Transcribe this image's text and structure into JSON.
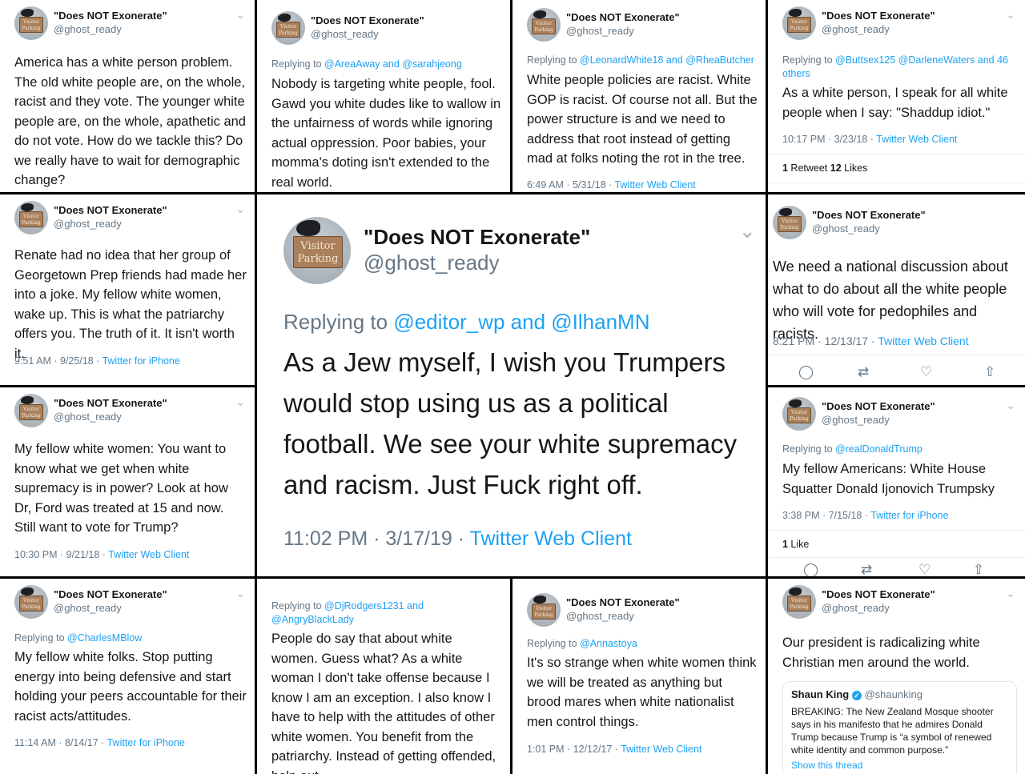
{
  "account": {
    "name": "\"Does NOT Exonerate\"",
    "handle": "@ghost_ready",
    "avatar_sign_text": "Visitor Parking"
  },
  "tweets": [
    {
      "body": "America has a white person problem. The old white people are, on the whole, racist and they vote. The younger white people are, on the whole, apathetic and do not vote. How do we tackle this? Do we really have to wait for demographic change?"
    },
    {
      "reply_prefix": "Replying to ",
      "reply_to": "@AreaAway and @sarahjeong",
      "body": "Nobody is targeting white people, fool. Gawd you white dudes like to wallow in the unfairness of words while ignoring actual oppression. Poor  babies, your momma's doting isn't extended to the real world."
    },
    {
      "reply_prefix": "Replying to ",
      "reply_to": "@LeonardWhite18 and @RheaButcher",
      "body": "White people policies are racist. White GOP is racist. Of course not all. But the power structure is and we need to address that root instead of getting mad at folks noting the rot in the tree.",
      "time": "6:49 AM · 5/31/18 · ",
      "source": "Twitter Web Client"
    },
    {
      "reply_prefix": "Replying to ",
      "reply_to": "@Buttsex125 @DarleneWaters and 46 others",
      "body": "As a white person, I speak for all white people when I say: \"Shaddup idiot.\"",
      "time": "10:17 PM · 3/23/18 · ",
      "source": "Twitter Web Client",
      "retweets": "1",
      "retweets_label": " Retweet ",
      "likes": "12",
      "likes_label": " Likes"
    },
    {
      "body": "Renate had no idea that her group of Georgetown Prep friends had made her into a joke. My fellow white women, wake up. This is what the patriarchy offers you. The truth of it. It isn't worth it.",
      "time": "9:51 AM · 9/25/18 · ",
      "source": "Twitter for iPhone"
    },
    {
      "reply_prefix": "Replying to ",
      "reply_to": "@editor_wp and @IlhanMN",
      "body": "As a Jew myself, I wish you Trumpers would stop using us as a political football. We see your white supremacy and racism. Just Fuck right off.",
      "time": "11:02 PM · 3/17/19 · ",
      "source": "Twitter Web Client"
    },
    {
      "body": "We need a national discussion about what to do about all the white people who will vote for pedophiles and racists.",
      "time": "8:21 PM · 12/13/17 · ",
      "source": "Twitter Web Client"
    },
    {
      "body": "My fellow white women: You want to know what we get when white supremacy is in power? Look at how Dr, Ford was treated at 15 and now. Still want to vote for Trump?",
      "time": "10:30 PM · 9/21/18 · ",
      "source": "Twitter Web Client"
    },
    {
      "reply_prefix": "Replying to ",
      "reply_to": "@realDonaldTrump",
      "body": "My fellow Americans: White House Squatter Donald Ijonovich Trumpsky",
      "time": "3:38 PM · 7/15/18 · ",
      "source": "Twitter for iPhone",
      "likes": "1",
      "likes_label": " Like"
    },
    {
      "reply_prefix": "Replying to ",
      "reply_to": "@CharlesMBlow",
      "body": "My fellow white folks. Stop putting energy into being defensive and start holding your peers accountable for their racist acts/attitudes.",
      "time": "11:14 AM · 8/14/17 · ",
      "source": "Twitter for iPhone"
    },
    {
      "reply_prefix": "Replying to ",
      "reply_to": "@DjRodgers1231 and @AngryBlackLady",
      "body": "People do say that about white women. Guess what? As a white woman I don't take offense because I know I am an exception. I also know I have to help with the attitudes of other white women. You benefit from the patriarchy. Instead of getting offended, help out."
    },
    {
      "reply_prefix": "Replying to ",
      "reply_to": "@Annastoya",
      "body": "It's so strange when white women think we will be treated as anything but brood mares when white nationalist men control things.",
      "time": "1:01 PM · 12/12/17 · ",
      "source": "Twitter Web Client"
    },
    {
      "body": "Our president is radicalizing white Christian men around the world.",
      "quote": {
        "name": "Shaun King",
        "handle": "@shaunking",
        "text": "BREAKING: The New Zealand Mosque shooter says in his manifesto that he admires Donald Trump because Trump is “a symbol of renewed white identity and common purpose.”",
        "thread": "Show this thread"
      }
    }
  ],
  "icons": {
    "chevron": "chevron-down-icon",
    "reply": "reply-icon",
    "retweet": "retweet-icon",
    "like": "heart-icon",
    "share": "share-icon"
  },
  "colors": {
    "link": "#1da1f2",
    "muted": "#657786",
    "text": "#14171a",
    "divider": "#000000"
  }
}
